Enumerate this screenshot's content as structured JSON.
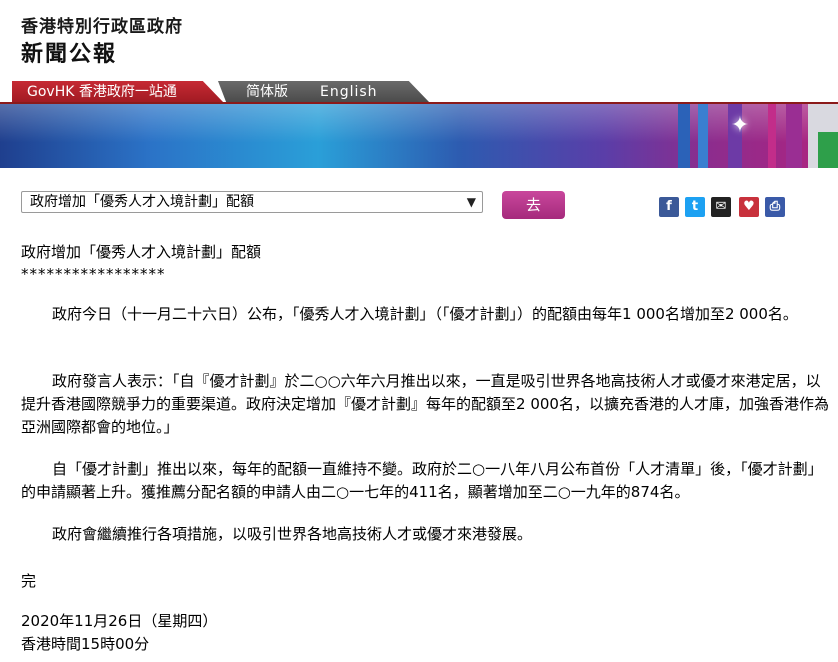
{
  "header": {
    "org": "香港特別行政區政府",
    "publication": "新聞公報"
  },
  "nav": {
    "govhk": "GovHK 香港政府一站通",
    "simplified": "简体版",
    "english": "English"
  },
  "selector": {
    "selected": "政府增加「優秀人才入境計劃」配額",
    "go_label": "去"
  },
  "share_icons": [
    "facebook-icon",
    "twitter-icon",
    "email-icon",
    "bookmark-icon",
    "print-icon"
  ],
  "article": {
    "title": "政府增加「優秀人才入境計劃」配額",
    "stars": "*****************",
    "paragraphs": [
      "政府今日（十一月二十六日）公布，「優秀人才入境計劃」（「優才計劃」）的配額由每年1 000名增加至2 000名。",
      "政府發言人表示：「自『優才計劃』於二○○六年六月推出以來，一直是吸引世界各地高技術人才或優才來港定居，以提升香港國際競爭力的重要渠道。政府決定增加『優才計劃』每年的配額至2 000名，以擴充香港的人才庫，加強香港作為亞洲國際都會的地位。」",
      "自「優才計劃」推出以來，每年的配額一直維持不變。政府於二○一八年八月公布首份「人才清單」後，「優才計劃」的申請顯著上升。獲推薦分配名額的申請人由二○一七年的411名，顯著增加至二○一九年的874名。",
      "政府會繼續推行各項措施，以吸引世界各地高技術人才或優才來港發展。"
    ],
    "end": "完",
    "date": "2020年11月26日（星期四）",
    "time": "香港時間15時00分"
  },
  "colors": {
    "nav_red": "#b0222b",
    "go_button": "#b4368a"
  }
}
